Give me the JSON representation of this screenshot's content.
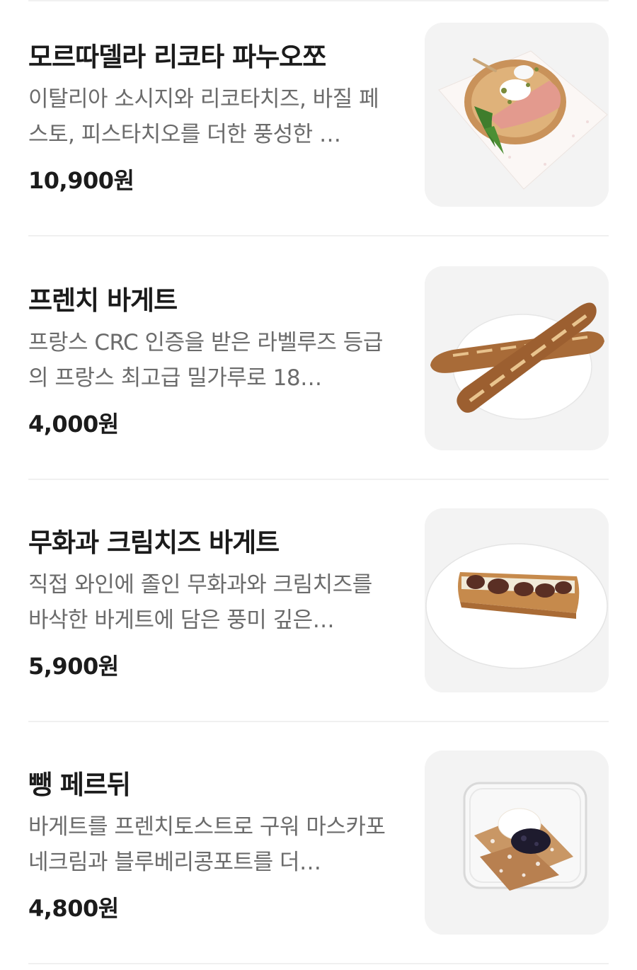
{
  "menu": {
    "items": [
      {
        "name": "모르따델라 리코타 파누오쪼",
        "description": "이탈리아 소시지와 리코타치즈, 바질 페스토, 피스타치오를 더한 풍성한 …",
        "price": "10,900원",
        "image": "panuozzo-sandwich"
      },
      {
        "name": "프렌치 바게트",
        "description": "프랑스 CRC 인증을 받은 라벨루즈 등급의 프랑스 최고급 밀가루로 18…",
        "price": "4,000원",
        "image": "baguette-on-plate"
      },
      {
        "name": "무화과 크림치즈 바게트",
        "description": "직접 와인에 졸인 무화과와 크림치즈를 바삭한 바게트에 담은 풍미 깊은…",
        "price": "5,900원",
        "image": "fig-cream-cheese-baguette"
      },
      {
        "name": "뺑 페르뒤",
        "description": "바게트를 프렌치토스트로 구워 마스카포네크림과 블루베리콩포트를 더…",
        "price": "4,800원",
        "image": "pain-perdu-box"
      }
    ]
  }
}
